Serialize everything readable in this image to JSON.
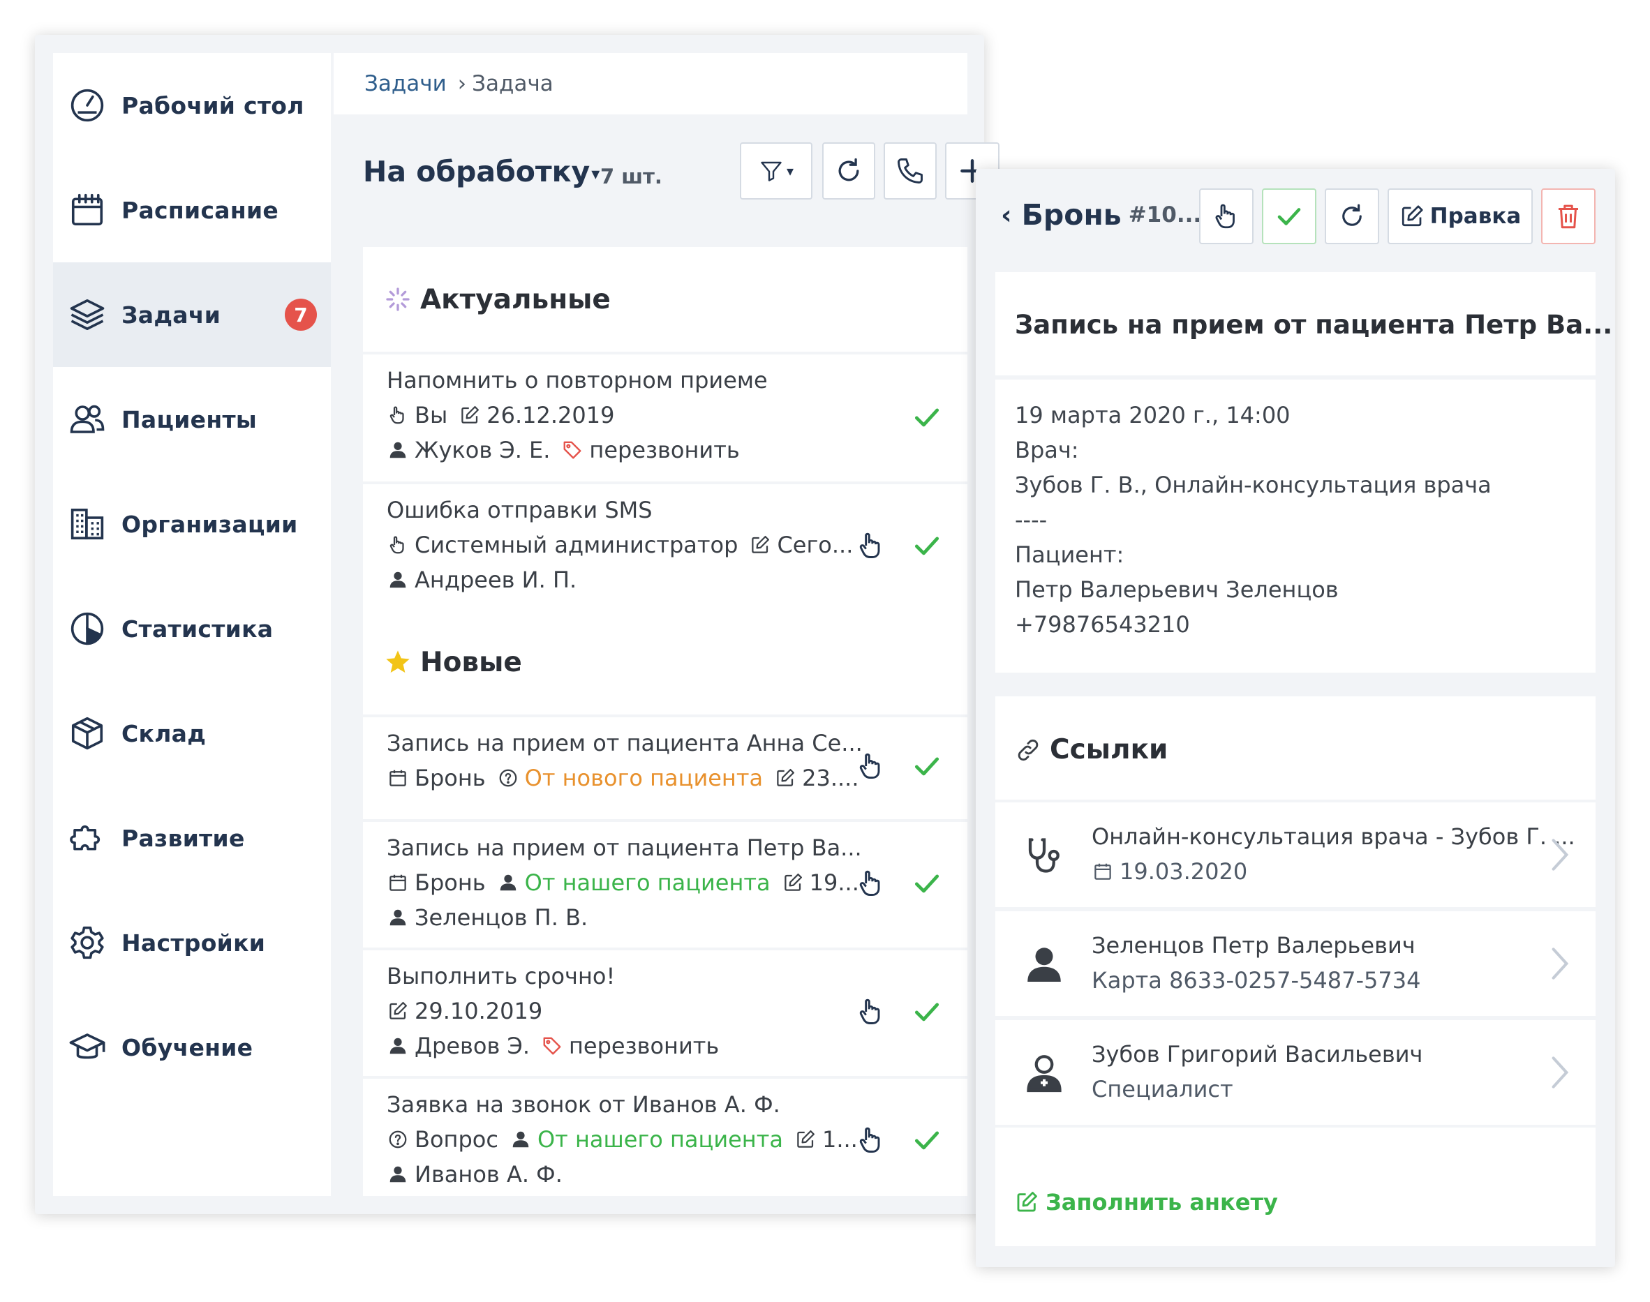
{
  "sidebar": {
    "items": [
      {
        "label": "Рабочий стол",
        "icon": "dashboard-gauge-icon"
      },
      {
        "label": "Расписание",
        "icon": "calendar-icon"
      },
      {
        "label": "Задачи",
        "icon": "layers-icon",
        "badge": "7",
        "active": true
      },
      {
        "label": "Пациенты",
        "icon": "users-icon"
      },
      {
        "label": "Организации",
        "icon": "buildings-icon"
      },
      {
        "label": "Статистика",
        "icon": "pie-chart-icon"
      },
      {
        "label": "Склад",
        "icon": "box-icon"
      },
      {
        "label": "Развитие",
        "icon": "puzzle-icon"
      },
      {
        "label": "Настройки",
        "icon": "gear-icon"
      },
      {
        "label": "Обучение",
        "icon": "graduation-cap-icon"
      }
    ]
  },
  "breadcrumb": {
    "root": "Задачи",
    "current": "Задача"
  },
  "list_header": {
    "title": "На обработку",
    "count": "7 шт."
  },
  "groups": {
    "actual": "Актуальные",
    "new": "Новые"
  },
  "tasks": [
    {
      "title": "Напомнить о повторном приеме",
      "executor": "Вы",
      "date": "26.12.2019",
      "person": "Жуков Э. Е.",
      "tag": "перезвонить"
    },
    {
      "title": "Ошибка отправки SMS",
      "executor": "Системный администратор",
      "date": "Сего...",
      "person": "Андреев И. П."
    },
    {
      "title": "Запись на прием от пациента Анна Се...",
      "type": "Бронь",
      "source": "От нового пациента",
      "date": "23...."
    },
    {
      "title": "Запись на прием от пациента Петр Ва...",
      "type": "Бронь",
      "source": "От нашего пациента",
      "date": "19...",
      "person": "Зеленцов П. В."
    },
    {
      "title": "Выполнить срочно!",
      "date": "29.10.2019",
      "person": "Древов Э.",
      "tag": "перезвонить"
    },
    {
      "title": "Заявка на звонок от Иванов А. Ф.",
      "type": "Вопрос",
      "source": "От нашего пациента",
      "date": "1...",
      "person": "Иванов А. Ф."
    }
  ],
  "detail": {
    "back_label": "Бронь",
    "number": "#10...",
    "edit_label": "Правка",
    "title": "Запись на прием от пациента Петр Ва...",
    "lines": [
      "19 марта 2020 г., 14:00",
      "Врач:",
      "Зубов Г. В., Онлайн-консультация врача",
      "----",
      "Пациент:",
      "Петр Валерьевич Зеленцов",
      "+79876543210"
    ],
    "links_title": "Ссылки",
    "links": [
      {
        "line1": "Онлайн-консультация врача - Зубов Г. ...",
        "line2": "19.03.2020",
        "icon": "stethoscope-icon"
      },
      {
        "line1": "Зеленцов Петр Валерьевич",
        "line2": "Карта 8633-0257-5487-5734",
        "icon": "person-icon"
      },
      {
        "line1": "Зубов Григорий Васильевич",
        "line2": "Специалист",
        "icon": "doctor-icon"
      }
    ],
    "fill_form": "Заполнить анкету"
  },
  "colors": {
    "accent_dark": "#23344e",
    "green": "#3bb44a",
    "orange": "#e8912d",
    "red": "#e5534b",
    "background": "#f2f4f7"
  }
}
